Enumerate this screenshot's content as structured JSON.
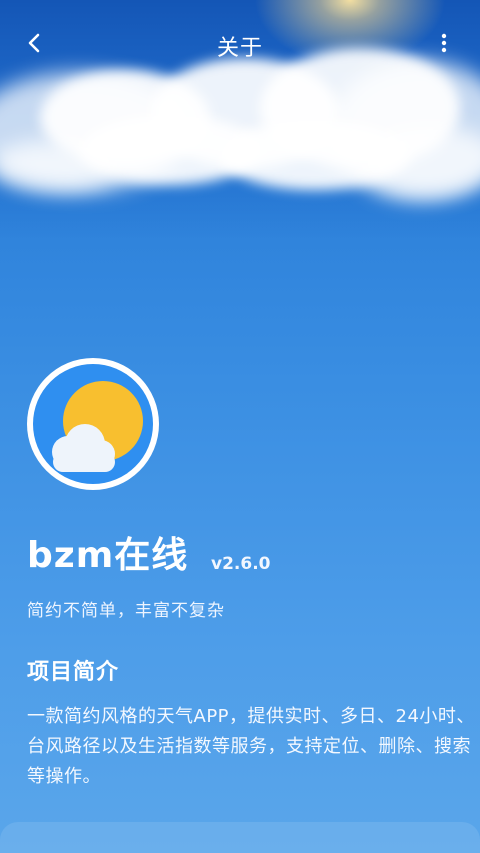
{
  "appbar": {
    "title": "关于",
    "back_icon": "chevron-left-icon",
    "more_icon": "more-vertical-icon"
  },
  "app": {
    "logo_icon": "sun-cloud-icon",
    "name": "bzm在线",
    "version": "v2.6.0",
    "slogan": "简约不简单，丰富不复杂"
  },
  "intro": {
    "title": "项目简介",
    "text": "一款简约风格的天气APP，提供实时、多日、24小时、台风路径以及生活指数等服务，支持定位、删除、搜索等操作。"
  },
  "colors": {
    "sky_top": "#1456b6",
    "sky_bottom": "#5aa6ea",
    "logo_bg": "#2f8ff0",
    "sun": "#f8bf2f"
  }
}
